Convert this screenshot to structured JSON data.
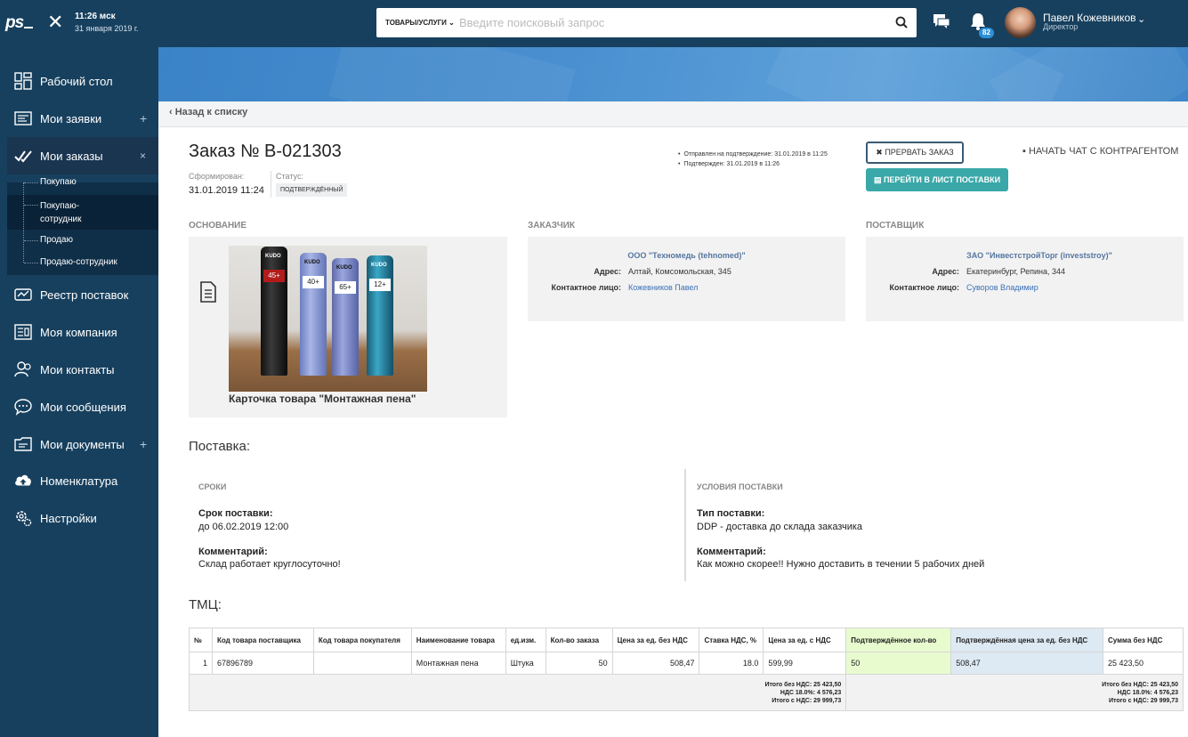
{
  "topbar": {
    "logo": "ps",
    "time": "11:26 мск",
    "date": "31 января 2019 г.",
    "search_category": "ТОВАРЫ/УСЛУГИ",
    "search_placeholder": "Введите поисковый запрос",
    "notifications_count": "82",
    "user_name": "Павел Кожевников",
    "user_role": "Директор"
  },
  "sidebar": {
    "items": [
      {
        "label": "Рабочий стол",
        "icon": "dashboard-icon"
      },
      {
        "label": "Мои заявки",
        "icon": "requests-icon",
        "plus": "+"
      },
      {
        "label": "Мои заказы",
        "icon": "orders-icon",
        "plus": "×"
      },
      {
        "label": "Реестр поставок",
        "icon": "registry-icon"
      },
      {
        "label": "Моя компания",
        "icon": "company-icon"
      },
      {
        "label": "Мои контакты",
        "icon": "contacts-icon"
      },
      {
        "label": "Мои сообщения",
        "icon": "messages-icon"
      },
      {
        "label": "Мои документы",
        "icon": "documents-icon",
        "plus": "+"
      },
      {
        "label": "Номенклатура",
        "icon": "cloud-icon"
      },
      {
        "label": "Настройки",
        "icon": "settings-icon"
      }
    ],
    "subitems": [
      "Покупаю",
      "Покупаю-\nсотрудник",
      "Продаю",
      "Продаю-сотрудник"
    ]
  },
  "page": {
    "back": "Назад к списку",
    "title": "Заказ № В-021303",
    "formed_label": "Сформирован:",
    "formed_value": "31.01.2019 11:24",
    "status_label": "Статус:",
    "status_value": "ПОДТВЕРЖДЁННЫЙ",
    "events": [
      "Отправлен на подтверждение: 31.01.2019 в 11:25",
      "Подтвержден: 31.01.2019 в 11:26"
    ],
    "abort_button": "ПРЕРВАТЬ ЗАКАЗ",
    "go_button": "ПЕРЕЙТИ В ЛИСТ ПОСТАВКИ",
    "chat_link": "НАЧАТЬ ЧАТ С КОНТРАГЕНТОМ"
  },
  "basis": {
    "heading": "ОСНОВАНИЕ",
    "caption": "Карточка товара \"Монтажная пена\"",
    "can_labels": [
      "45+",
      "40+",
      "65+",
      "12+"
    ],
    "brand": "KUDO"
  },
  "customer": {
    "heading": "ЗАКАЗЧИК",
    "name": "ООО \"Техномедь (tehnomed)\"",
    "address_label": "Адрес:",
    "address": "Алтай, Комсомольская, 345",
    "contact_label": "Контактное лицо:",
    "contact": "Кожевников Павел"
  },
  "supplier": {
    "heading": "ПОСТАВЩИК",
    "name": "ЗАО \"ИнвестстройТорг (investstroy)\"",
    "address_label": "Адрес:",
    "address": "Екатеринбург, Репина, 344",
    "contact_label": "Контактное лицо:",
    "contact": "Суворов Владимир"
  },
  "delivery": {
    "heading": "Поставка:",
    "terms_heading": "СРОКИ",
    "term_label": "Срок поставки:",
    "term_value": "до 06.02.2019 12:00",
    "comment_label": "Комментарий:",
    "comment_value": "Склад работает круглосуточно!",
    "cond_heading": "УСЛОВИЯ ПОСТАВКИ",
    "type_label": "Тип поставки:",
    "type_value": "DDP - доставка до склада заказчика",
    "comment2_label": "Комментарий:",
    "comment2_value": "Как можно скорее!! Нужно доставить в течении 5 рабочих дней"
  },
  "goods": {
    "heading": "ТМЦ:",
    "columns": [
      "№",
      "Код товара поставщика",
      "Код товара покупателя",
      "Наименование товара",
      "ед.изм.",
      "Кол-во заказа",
      "Цена за ед. без НДС",
      "Ставка НДС, %",
      "Цена за ед. с НДС",
      "Подтверждённое кол-во",
      "Подтверждённая цена за ед. без НДС",
      "Сумма без НДС"
    ],
    "rows": [
      [
        "1",
        "67896789",
        "",
        "Монтажная пена",
        "Штука",
        "50",
        "508,47",
        "18.0",
        "599,99",
        "50",
        "508,47",
        "25 423,50"
      ]
    ],
    "totals_left": [
      "Итого без НДС: 25 423,50",
      "НДС 18.0%: 4 576,23",
      "Итого с НДС: 29 999,73"
    ],
    "totals_right": [
      "Итого без НДС: 25 423,50",
      "НДС 18.0%: 4 576,23",
      "Итого с НДС: 29 999,73"
    ]
  }
}
